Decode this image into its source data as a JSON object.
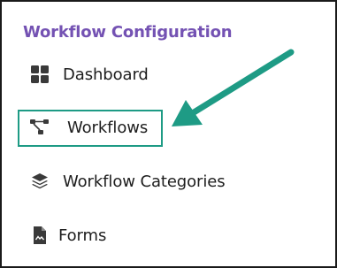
{
  "sidebar": {
    "section_title": "Workflow Configuration",
    "items": [
      {
        "label": "Dashboard",
        "icon": "dashboard-grid-icon"
      },
      {
        "label": "Workflows",
        "icon": "workflow-nodes-icon",
        "highlighted": true
      },
      {
        "label": "Workflow Categories",
        "icon": "layers-stack-icon"
      },
      {
        "label": "Forms",
        "icon": "form-document-icon"
      }
    ]
  },
  "colors": {
    "title": "#7452b3",
    "icon": "#3a3a3a",
    "highlight": "#1e9b85"
  }
}
